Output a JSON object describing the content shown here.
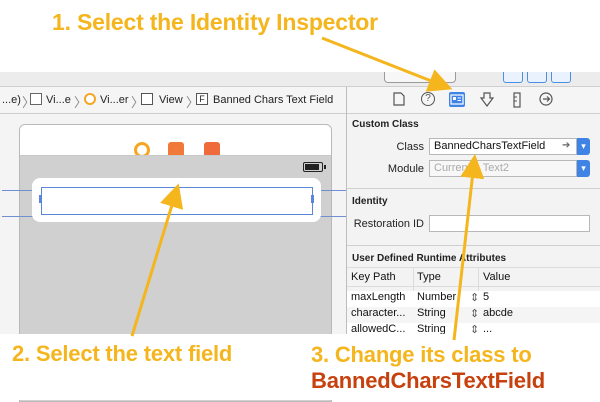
{
  "annotations": {
    "step1": "1. Select the Identity Inspector",
    "step2": "2. Select the text field",
    "step3_line1": "3. Change its class to",
    "step3_class": "BannedCharsTextField"
  },
  "jumpbar": {
    "items": [
      "...e)",
      "Vi...e",
      "Vi...er",
      "View",
      "Banned Chars Text Field"
    ]
  },
  "inspector": {
    "custom_class": {
      "heading": "Custom Class",
      "class_label": "Class",
      "class_value": "BannedCharsTextField",
      "module_label": "Module",
      "module_placeholder": "Current – Text2"
    },
    "identity": {
      "heading": "Identity",
      "restoration_label": "Restoration ID",
      "restoration_value": ""
    },
    "user_defined": {
      "heading": "User Defined Runtime Attributes",
      "columns": [
        "Key Path",
        "Type",
        "Value"
      ],
      "rows": [
        {
          "key": "maxLength",
          "type": "Number",
          "value": "5"
        },
        {
          "key": "character...",
          "type": "String",
          "value": "abcde"
        },
        {
          "key": "allowedC...",
          "type": "String",
          "value": "..."
        }
      ]
    }
  },
  "colors": {
    "annotation": "#f5b51d",
    "annotation_class": "#c7410f",
    "selection": "#5a86d6",
    "inspector_active": "#3f84e5"
  },
  "icons": [
    "file-icon",
    "help-icon",
    "identity-inspector-icon",
    "attributes-icon",
    "size-icon",
    "connections-icon"
  ]
}
